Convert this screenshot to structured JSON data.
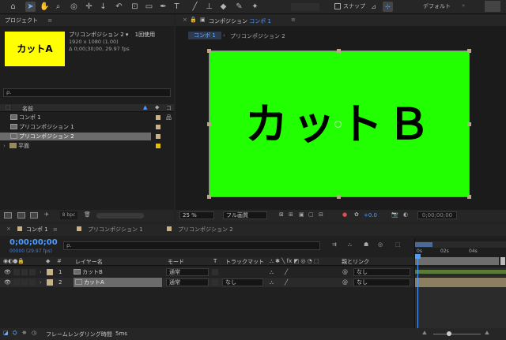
{
  "toolbar": {
    "snap_label": "スナップ",
    "workspace_label": "デフォルト"
  },
  "project": {
    "title": "プロジェクト",
    "thumb_text": "カットA",
    "selected_name": "プリコンポジション 2 ▾",
    "usage": "1回使用",
    "info_line1": "1920 x 1080 (1.00)",
    "info_line2": "Δ 0;00;30;00, 29.97 fps",
    "search_placeholder": "ρ.",
    "col_name": "名前",
    "items": [
      {
        "name": "コンポ 1",
        "color": "#c8b089",
        "kind": "comp"
      },
      {
        "name": "プリコンポジション 1",
        "color": "#c8b089",
        "kind": "comp"
      },
      {
        "name": "プリコンポジション 2",
        "color": "#c8b089",
        "kind": "comp"
      },
      {
        "name": "平面",
        "color": "#e5c000",
        "kind": "folder"
      }
    ],
    "bpc": "8 bpc"
  },
  "viewer": {
    "tab_label": "コンポジション",
    "tab_comp": "コンポ 1",
    "breadcrumb1": "コンポ 1",
    "breadcrumb2": "プリコンポジション 2",
    "frame_text": "カットＢ",
    "frame_color": "#22ff00",
    "zoom": "25 %",
    "quality": "フル画質",
    "exposure": "+0.0",
    "timecode": "0;00;00;00"
  },
  "timeline": {
    "tabs": [
      "コンポ 1",
      "プリコンポジション 1",
      "プリコンポジション 2"
    ],
    "timecode": "0;00;00;00",
    "frames": "00000 (29.97 fps)",
    "search_placeholder": "ρ.",
    "columns": {
      "layer_name": "レイヤー名",
      "mode": "モード",
      "t": "T",
      "track_matte": "トラックマット",
      "parent": "親とリンク"
    },
    "layers": [
      {
        "num": "1",
        "name": "カットB",
        "mode": "通常",
        "matte": "",
        "parent": "なし"
      },
      {
        "num": "2",
        "name": "カットA",
        "mode": "通常",
        "matte": "なし",
        "parent": "なし"
      }
    ],
    "ruler": [
      "0s",
      "02s",
      "04s"
    ],
    "render_label": "フレームレンダリング時間",
    "render_time": "5ms"
  }
}
